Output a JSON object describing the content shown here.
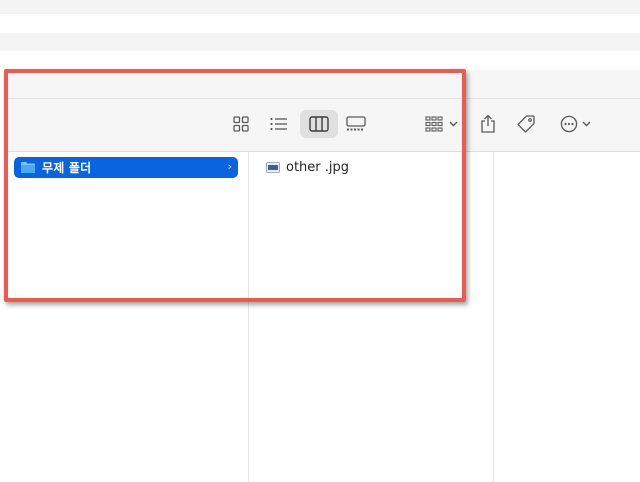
{
  "colors": {
    "selection": "#0a63e0",
    "highlight_border": "#ee5a4f",
    "toolbar_bg": "#f6f6f6",
    "icon": "#5a5a5a"
  },
  "toolbar": {
    "view_buttons": [
      {
        "name": "icon-view",
        "icon": "grid-icon",
        "active": false
      },
      {
        "name": "list-view",
        "icon": "list-icon",
        "active": false
      },
      {
        "name": "column-view",
        "icon": "columns-icon",
        "active": true
      },
      {
        "name": "gallery-view",
        "icon": "gallery-icon",
        "active": false
      }
    ],
    "actions": [
      {
        "name": "group-button",
        "icon": "group-grid-icon",
        "has_dropdown": true
      },
      {
        "name": "share-button",
        "icon": "share-icon",
        "has_dropdown": false
      },
      {
        "name": "tag-button",
        "icon": "tag-icon",
        "has_dropdown": false
      },
      {
        "name": "more-button",
        "icon": "ellipsis-circle-icon",
        "has_dropdown": true
      }
    ]
  },
  "columns": {
    "col1": {
      "items": [
        {
          "label": "무제 폴더",
          "icon": "folder-icon",
          "selected": true
        }
      ]
    },
    "col2": {
      "items": [
        {
          "label": "other .jpg",
          "icon": "image-file-icon",
          "selected": false
        }
      ]
    }
  }
}
